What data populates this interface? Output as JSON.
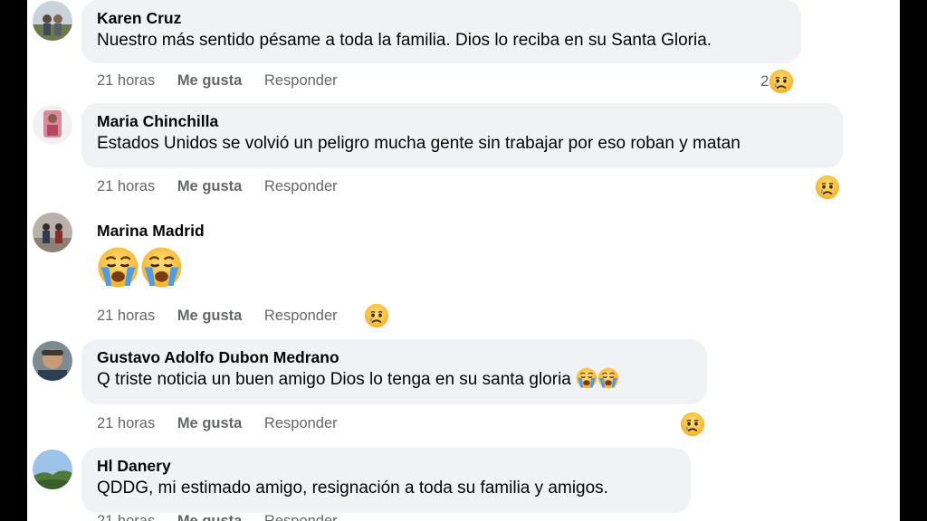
{
  "comments": [
    {
      "author": "Karen Cruz",
      "text": "Nuestro más sentido pésame a toda la familia. Dios lo reciba en su Santa Gloria.",
      "time": "21 horas",
      "like": "Me gusta",
      "reply": "Responder",
      "reaction_count": "2",
      "reaction_icon": "sad-emoji-icon"
    },
    {
      "author": "Maria Chinchilla",
      "text": "Estados Unidos se volvió un peligro mucha gente sin trabajar por eso roban y matan",
      "time": "21 horas",
      "like": "Me gusta",
      "reply": "Responder",
      "reaction_icon": "sad-emoji-icon"
    },
    {
      "author": "Marina Madrid",
      "text_emojis": [
        "crying-face-icon",
        "crying-face-icon"
      ],
      "time": "21 horas",
      "like": "Me gusta",
      "reply": "Responder",
      "reaction_icon": "sad-emoji-icon"
    },
    {
      "author": "Gustavo Adolfo Dubon Medrano",
      "text": "Q triste noticia un buen amigo Dios lo tenga en su santa gloria",
      "text_emojis": [
        "crying-face-icon",
        "crying-face-icon"
      ],
      "time": "21 horas",
      "like": "Me gusta",
      "reply": "Responder",
      "reaction_icon": "sad-emoji-icon"
    },
    {
      "author": "Hl Danery",
      "text": "QDDG, mi estimado amigo, resignación a toda su familia y amigos.",
      "time": "21 horas",
      "like": "Me gusta",
      "reply": "Responder"
    }
  ],
  "colors": {
    "bubble": "#f0f2f5",
    "text": "#050505",
    "secondary": "#65676b",
    "emoji_yellow": "#f7b125",
    "tear_blue": "#4e9ce8"
  }
}
